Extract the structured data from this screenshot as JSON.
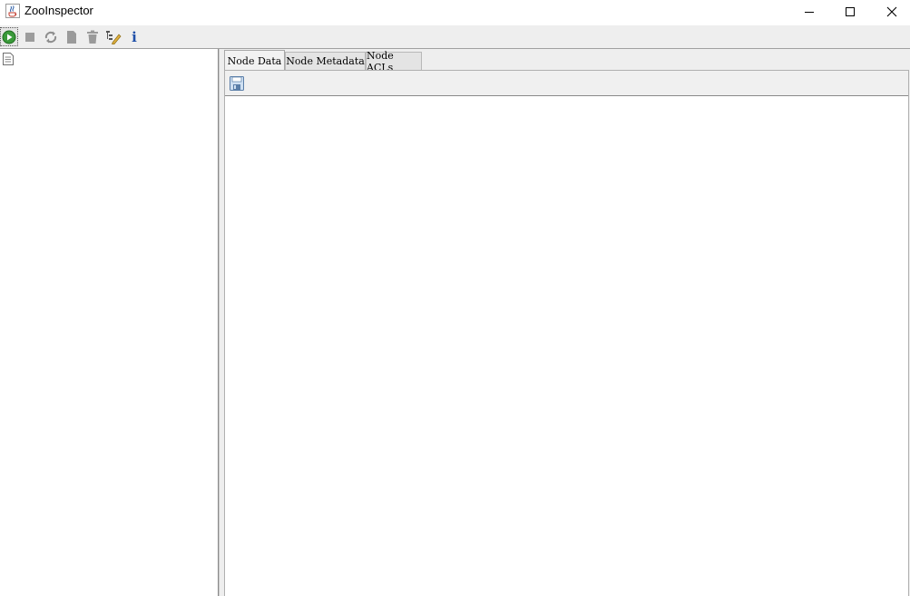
{
  "window": {
    "title": "ZooInspector",
    "app_icon": "java-cup-icon"
  },
  "window_controls": {
    "minimize_icon": "minimize-icon",
    "maximize_icon": "maximize-icon",
    "close_icon": "close-icon"
  },
  "toolbar": {
    "buttons": [
      {
        "icon": "connect-icon",
        "tooltip": ""
      },
      {
        "icon": "disconnect-icon",
        "tooltip": ""
      },
      {
        "icon": "refresh-icon",
        "tooltip": ""
      },
      {
        "icon": "add-node-icon",
        "tooltip": ""
      },
      {
        "icon": "delete-node-icon",
        "tooltip": ""
      },
      {
        "icon": "node-viewers-icon",
        "tooltip": ""
      },
      {
        "icon": "about-icon",
        "tooltip": ""
      }
    ],
    "about_glyph": "i"
  },
  "tree": {
    "root_icon": "document-icon"
  },
  "tabs": [
    {
      "label": "Node Data",
      "active": true
    },
    {
      "label": "Node Metadata",
      "active": false
    },
    {
      "label": "Node ACLs",
      "active": false
    }
  ],
  "node_data": {
    "save_icon": "save-icon",
    "content": ""
  },
  "colors": {
    "accent_green": "#2e8b2e",
    "info_blue": "#1f4fa8"
  }
}
